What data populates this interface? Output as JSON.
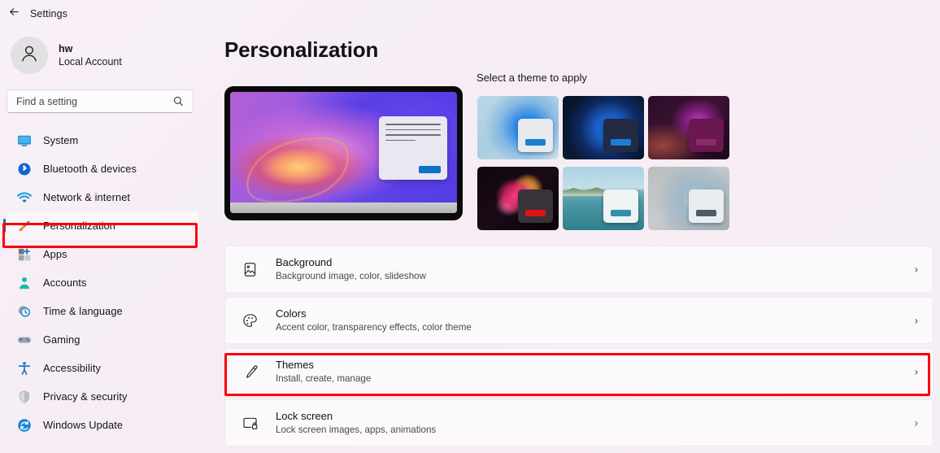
{
  "titlebar": {
    "back_icon": "back-arrow-icon",
    "title": "Settings"
  },
  "sidebar": {
    "account": {
      "name": "hw",
      "subtitle": "Local Account",
      "avatar_icon": "person-avatar-icon"
    },
    "search": {
      "placeholder": "Find a setting",
      "value": "",
      "icon": "search-icon"
    },
    "items": [
      {
        "label": "System",
        "icon": "monitor-icon",
        "selected": false
      },
      {
        "label": "Bluetooth & devices",
        "icon": "bluetooth-icon",
        "selected": false
      },
      {
        "label": "Network & internet",
        "icon": "wifi-icon",
        "selected": false
      },
      {
        "label": "Personalization",
        "icon": "paintbrush-icon",
        "selected": true
      },
      {
        "label": "Apps",
        "icon": "apps-icon",
        "selected": false
      },
      {
        "label": "Accounts",
        "icon": "person-icon",
        "selected": false
      },
      {
        "label": "Time & language",
        "icon": "clock-icon",
        "selected": false
      },
      {
        "label": "Gaming",
        "icon": "gamepad-icon",
        "selected": false
      },
      {
        "label": "Accessibility",
        "icon": "accessibility-icon",
        "selected": false
      },
      {
        "label": "Privacy & security",
        "icon": "shield-icon",
        "selected": false
      },
      {
        "label": "Windows Update",
        "icon": "update-refresh-icon",
        "selected": false
      }
    ]
  },
  "main": {
    "page_title": "Personalization",
    "preview": {
      "name": "theme-preview-monitor",
      "window_button_color": "#0b72c4",
      "line_count": 4
    },
    "themes": {
      "label": "Select a theme to apply",
      "items": [
        {
          "name": "theme-bloom-light",
          "art": "art-bloom-light",
          "window_color": "#e8eaee",
          "accent": "#1a7fd4"
        },
        {
          "name": "theme-bloom-dark",
          "art": "art-bloom-dark",
          "window_color": "#232a44",
          "accent": "#1a7fd4"
        },
        {
          "name": "theme-glow-purple",
          "art": "art-glow-purple",
          "window_color": "#6b1750",
          "accent": "#8a2a66"
        },
        {
          "name": "theme-flower-dark",
          "art": "art-flower",
          "window_color": "#38323a",
          "accent": "#e01414"
        },
        {
          "name": "theme-lake",
          "art": "art-lake",
          "window_color": "#eef3f4",
          "accent": "#2f90a6"
        },
        {
          "name": "theme-bloom-gray",
          "art": "art-bloom-gray",
          "window_color": "#e9edef",
          "accent": "#4e5a63"
        }
      ]
    },
    "rows": [
      {
        "title": "Background",
        "subtitle": "Background image, color, slideshow",
        "icon": "picture-icon",
        "chevron": "›",
        "highlighted": false
      },
      {
        "title": "Colors",
        "subtitle": "Accent color, transparency effects, color theme",
        "icon": "palette-icon",
        "chevron": "›",
        "highlighted": false
      },
      {
        "title": "Themes",
        "subtitle": "Install, create, manage",
        "icon": "paintbrush-row-icon",
        "chevron": "›",
        "highlighted": true
      },
      {
        "title": "Lock screen",
        "subtitle": "Lock screen images, apps, animations",
        "icon": "lockscreen-icon",
        "chevron": "›",
        "highlighted": false
      }
    ]
  },
  "annotations": {
    "color": "#fb0006",
    "targets": [
      "sidebar-item-personalization",
      "settings-row-themes"
    ]
  }
}
